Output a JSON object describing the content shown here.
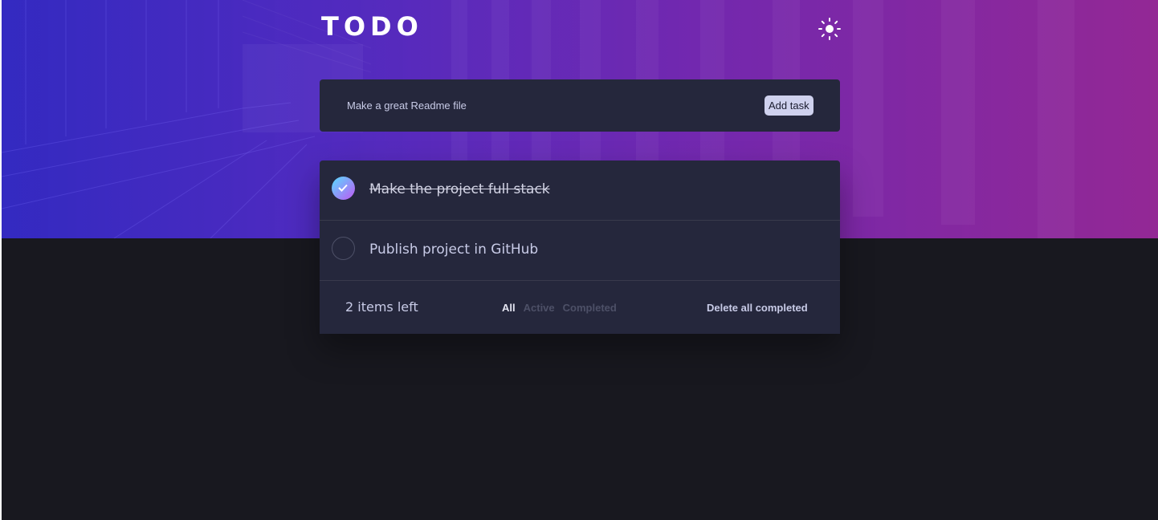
{
  "app": {
    "title": "TODO",
    "theme_icon": "sun-icon"
  },
  "new_task": {
    "value": "Make a great Readme file",
    "add_label": "Add task"
  },
  "tasks": [
    {
      "text": "Make the project full stack",
      "completed": true
    },
    {
      "text": "Publish project in GitHub",
      "completed": false
    }
  ],
  "footer": {
    "items_left": "2 items left",
    "filters": [
      "All",
      "Active",
      "Completed"
    ],
    "active_filter": "All",
    "clear_label": "Delete all completed"
  },
  "colors": {
    "background": "#18181f",
    "card": "#25273c",
    "text": "#c8cbe7",
    "check_gradient_start": "#57ddff",
    "check_gradient_end": "#c058f3"
  }
}
